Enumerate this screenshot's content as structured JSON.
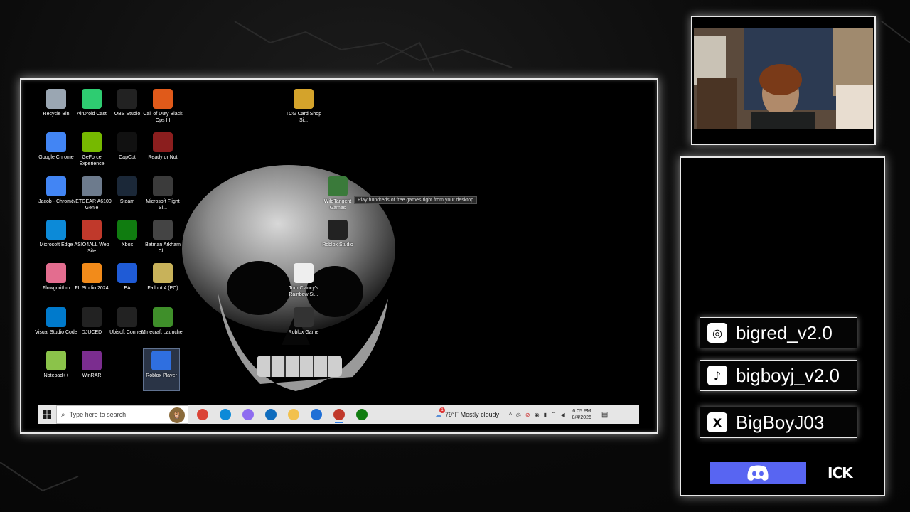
{
  "desktop": {
    "icons": [
      {
        "label": "Recycle Bin",
        "icon": "recycle-bin-icon",
        "color": "#9aa6b2"
      },
      {
        "label": "AirDroid Cast",
        "icon": "airdroid-cast-icon",
        "color": "#2ecc71"
      },
      {
        "label": "OBS Studio",
        "icon": "obs-studio-icon",
        "color": "#222222"
      },
      {
        "label": "Call of Duty Black Ops III",
        "icon": "call-of-duty-icon",
        "color": "#e05a1a"
      },
      {
        "label": "TCG Card Shop Si...",
        "icon": "tcg-card-shop-icon",
        "color": "#d4a32b"
      },
      {
        "label": "Google Chrome",
        "icon": "chrome-icon",
        "color": "#4285f4"
      },
      {
        "label": "GeForce Experience",
        "icon": "geforce-icon",
        "color": "#76b900"
      },
      {
        "label": "CapCut",
        "icon": "capcut-icon",
        "color": "#111111"
      },
      {
        "label": "Ready or Not",
        "icon": "ready-or-not-icon",
        "color": "#8b1e1e"
      },
      {
        "label": "Jacob - Chrome",
        "icon": "chrome-profile-icon",
        "color": "#4285f4"
      },
      {
        "label": "NETGEAR A6100 Genie",
        "icon": "netgear-icon",
        "color": "#6d7b8d"
      },
      {
        "label": "Steam",
        "icon": "steam-icon",
        "color": "#1b2838"
      },
      {
        "label": "Microsoft Flight Si...",
        "icon": "flight-simulator-icon",
        "color": "#3b3b3b"
      },
      {
        "label": "Microsoft Edge",
        "icon": "edge-icon",
        "color": "#0c8ad8"
      },
      {
        "label": "ASIO4ALL Web Site",
        "icon": "asio4all-icon",
        "color": "#c0392b"
      },
      {
        "label": "Xbox",
        "icon": "xbox-icon",
        "color": "#107c10"
      },
      {
        "label": "Batman Arkham Cl...",
        "icon": "batman-icon",
        "color": "#444444"
      },
      {
        "label": "Flowgorithm",
        "icon": "flowgorithm-icon",
        "color": "#e36d8f"
      },
      {
        "label": "FL Studio 2024",
        "icon": "fl-studio-icon",
        "color": "#f28b1a"
      },
      {
        "label": "EA",
        "icon": "ea-icon",
        "color": "#1f5bd6"
      },
      {
        "label": "Fallout 4 (PC)",
        "icon": "fallout-icon",
        "color": "#c8b25a"
      },
      {
        "label": "Visual Studio Code",
        "icon": "vscode-icon",
        "color": "#007acc"
      },
      {
        "label": "DJUCED",
        "icon": "djuced-icon",
        "color": "#222222"
      },
      {
        "label": "Ubisoft Connect",
        "icon": "ubisoft-icon",
        "color": "#222222"
      },
      {
        "label": "Minecraft Launcher",
        "icon": "minecraft-icon",
        "color": "#3f8f2a"
      },
      {
        "label": "Notepad++",
        "icon": "notepad-plus-plus-icon",
        "color": "#8bc34a"
      },
      {
        "label": "WinRAR",
        "icon": "winrar-icon",
        "color": "#7b2d8f"
      },
      {
        "label": "Roblox Player",
        "icon": "roblox-player-icon",
        "color": "#2f6fe0"
      },
      {
        "label": "WildTangent Games",
        "icon": "wildtangent-icon",
        "color": "#3a7a3a"
      },
      {
        "label": "Roblox Studio",
        "icon": "roblox-studio-icon",
        "color": "#222222"
      },
      {
        "label": "Tom Clancy's Rainbow Si...",
        "icon": "rainbow-six-icon",
        "color": "#eeeeee"
      },
      {
        "label": "Roblox Game",
        "icon": "roblox-game-icon",
        "color": "#333333"
      }
    ],
    "tooltip": "Play hundreds of free games right from your desktop"
  },
  "taskbar": {
    "search_placeholder": "Type here to search",
    "apps": [
      {
        "name": "chrome",
        "color": "#db4437"
      },
      {
        "name": "edge",
        "color": "#0c8ad8"
      },
      {
        "name": "copilot",
        "color": "#8e6cf0"
      },
      {
        "name": "outlook",
        "color": "#0f6cbd"
      },
      {
        "name": "file-explorer",
        "color": "#f2c14e"
      },
      {
        "name": "store",
        "color": "#1f6fd6"
      },
      {
        "name": "obs",
        "color": "#c0392b"
      },
      {
        "name": "xbox",
        "color": "#107c10"
      }
    ],
    "weather_badge": "1",
    "weather_text": "79°F  Mostly cloudy",
    "time": "6:05 PM",
    "date": "8/4/2026"
  },
  "socials": [
    {
      "platform": "instagram",
      "icon": "instagram-icon",
      "handle": "bigred_v2.0"
    },
    {
      "platform": "tiktok",
      "icon": "tiktok-icon",
      "handle": "bigboyj_v2.0"
    },
    {
      "platform": "x",
      "icon": "x-icon",
      "handle": "BigBoyJ03"
    }
  ],
  "discord": {
    "tag": "ICK",
    "color": "#5865f2"
  }
}
